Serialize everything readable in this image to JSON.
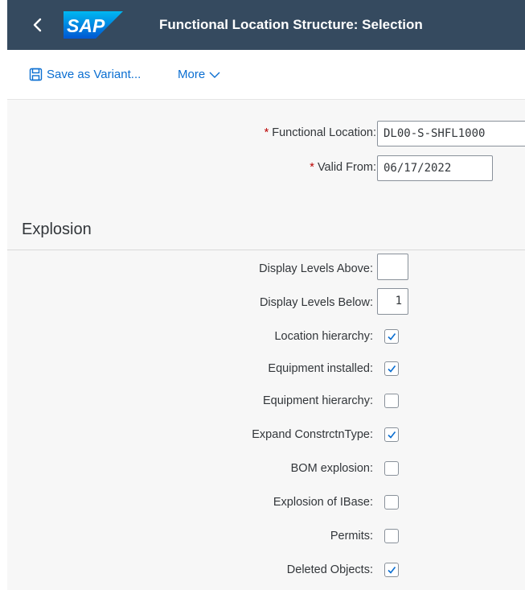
{
  "header": {
    "back_label": "<",
    "logo_text": "SAP",
    "title": "Functional Location Structure: Selection",
    "bg_color": "#354a5f"
  },
  "toolbar": {
    "save_variant_label": "Save as Variant...",
    "more_label": "More"
  },
  "form": {
    "required_mark": "*",
    "functional_location": {
      "label": "Functional Location:",
      "value": "DL00-S-SHFL1000"
    },
    "valid_from": {
      "label": "Valid From:",
      "value": "06/17/2022"
    }
  },
  "explosion": {
    "section_title": "Explosion",
    "display_levels_above": {
      "label": "Display Levels Above:",
      "value": ""
    },
    "display_levels_below": {
      "label": "Display Levels Below:",
      "value": "1"
    },
    "checkboxes": [
      {
        "label": "Location hierarchy:",
        "checked": true
      },
      {
        "label": "Equipment installed:",
        "checked": true
      },
      {
        "label": "Equipment hierarchy:",
        "checked": false
      },
      {
        "label": "Expand ConstrctnType:",
        "checked": true
      },
      {
        "label": "BOM explosion:",
        "checked": false
      },
      {
        "label": "Explosion of IBase:",
        "checked": false
      },
      {
        "label": "Permits:",
        "checked": false
      },
      {
        "label": "Deleted Objects:",
        "checked": true
      }
    ]
  }
}
